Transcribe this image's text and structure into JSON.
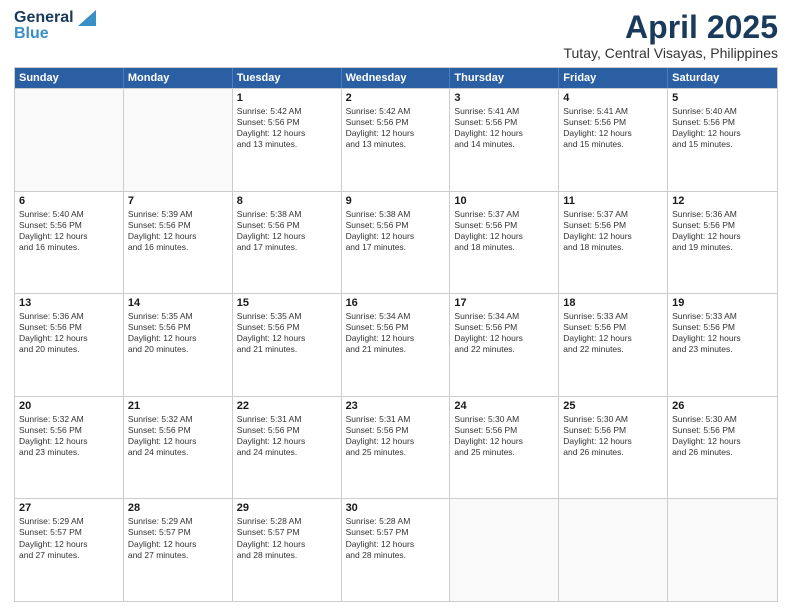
{
  "logo": {
    "general": "General",
    "blue": "Blue"
  },
  "title": "April 2025",
  "subtitle": "Tutay, Central Visayas, Philippines",
  "weekdays": [
    "Sunday",
    "Monday",
    "Tuesday",
    "Wednesday",
    "Thursday",
    "Friday",
    "Saturday"
  ],
  "weeks": [
    [
      {
        "day": "",
        "lines": []
      },
      {
        "day": "",
        "lines": []
      },
      {
        "day": "1",
        "lines": [
          "Sunrise: 5:42 AM",
          "Sunset: 5:56 PM",
          "Daylight: 12 hours",
          "and 13 minutes."
        ]
      },
      {
        "day": "2",
        "lines": [
          "Sunrise: 5:42 AM",
          "Sunset: 5:56 PM",
          "Daylight: 12 hours",
          "and 13 minutes."
        ]
      },
      {
        "day": "3",
        "lines": [
          "Sunrise: 5:41 AM",
          "Sunset: 5:56 PM",
          "Daylight: 12 hours",
          "and 14 minutes."
        ]
      },
      {
        "day": "4",
        "lines": [
          "Sunrise: 5:41 AM",
          "Sunset: 5:56 PM",
          "Daylight: 12 hours",
          "and 15 minutes."
        ]
      },
      {
        "day": "5",
        "lines": [
          "Sunrise: 5:40 AM",
          "Sunset: 5:56 PM",
          "Daylight: 12 hours",
          "and 15 minutes."
        ]
      }
    ],
    [
      {
        "day": "6",
        "lines": [
          "Sunrise: 5:40 AM",
          "Sunset: 5:56 PM",
          "Daylight: 12 hours",
          "and 16 minutes."
        ]
      },
      {
        "day": "7",
        "lines": [
          "Sunrise: 5:39 AM",
          "Sunset: 5:56 PM",
          "Daylight: 12 hours",
          "and 16 minutes."
        ]
      },
      {
        "day": "8",
        "lines": [
          "Sunrise: 5:38 AM",
          "Sunset: 5:56 PM",
          "Daylight: 12 hours",
          "and 17 minutes."
        ]
      },
      {
        "day": "9",
        "lines": [
          "Sunrise: 5:38 AM",
          "Sunset: 5:56 PM",
          "Daylight: 12 hours",
          "and 17 minutes."
        ]
      },
      {
        "day": "10",
        "lines": [
          "Sunrise: 5:37 AM",
          "Sunset: 5:56 PM",
          "Daylight: 12 hours",
          "and 18 minutes."
        ]
      },
      {
        "day": "11",
        "lines": [
          "Sunrise: 5:37 AM",
          "Sunset: 5:56 PM",
          "Daylight: 12 hours",
          "and 18 minutes."
        ]
      },
      {
        "day": "12",
        "lines": [
          "Sunrise: 5:36 AM",
          "Sunset: 5:56 PM",
          "Daylight: 12 hours",
          "and 19 minutes."
        ]
      }
    ],
    [
      {
        "day": "13",
        "lines": [
          "Sunrise: 5:36 AM",
          "Sunset: 5:56 PM",
          "Daylight: 12 hours",
          "and 20 minutes."
        ]
      },
      {
        "day": "14",
        "lines": [
          "Sunrise: 5:35 AM",
          "Sunset: 5:56 PM",
          "Daylight: 12 hours",
          "and 20 minutes."
        ]
      },
      {
        "day": "15",
        "lines": [
          "Sunrise: 5:35 AM",
          "Sunset: 5:56 PM",
          "Daylight: 12 hours",
          "and 21 minutes."
        ]
      },
      {
        "day": "16",
        "lines": [
          "Sunrise: 5:34 AM",
          "Sunset: 5:56 PM",
          "Daylight: 12 hours",
          "and 21 minutes."
        ]
      },
      {
        "day": "17",
        "lines": [
          "Sunrise: 5:34 AM",
          "Sunset: 5:56 PM",
          "Daylight: 12 hours",
          "and 22 minutes."
        ]
      },
      {
        "day": "18",
        "lines": [
          "Sunrise: 5:33 AM",
          "Sunset: 5:56 PM",
          "Daylight: 12 hours",
          "and 22 minutes."
        ]
      },
      {
        "day": "19",
        "lines": [
          "Sunrise: 5:33 AM",
          "Sunset: 5:56 PM",
          "Daylight: 12 hours",
          "and 23 minutes."
        ]
      }
    ],
    [
      {
        "day": "20",
        "lines": [
          "Sunrise: 5:32 AM",
          "Sunset: 5:56 PM",
          "Daylight: 12 hours",
          "and 23 minutes."
        ]
      },
      {
        "day": "21",
        "lines": [
          "Sunrise: 5:32 AM",
          "Sunset: 5:56 PM",
          "Daylight: 12 hours",
          "and 24 minutes."
        ]
      },
      {
        "day": "22",
        "lines": [
          "Sunrise: 5:31 AM",
          "Sunset: 5:56 PM",
          "Daylight: 12 hours",
          "and 24 minutes."
        ]
      },
      {
        "day": "23",
        "lines": [
          "Sunrise: 5:31 AM",
          "Sunset: 5:56 PM",
          "Daylight: 12 hours",
          "and 25 minutes."
        ]
      },
      {
        "day": "24",
        "lines": [
          "Sunrise: 5:30 AM",
          "Sunset: 5:56 PM",
          "Daylight: 12 hours",
          "and 25 minutes."
        ]
      },
      {
        "day": "25",
        "lines": [
          "Sunrise: 5:30 AM",
          "Sunset: 5:56 PM",
          "Daylight: 12 hours",
          "and 26 minutes."
        ]
      },
      {
        "day": "26",
        "lines": [
          "Sunrise: 5:30 AM",
          "Sunset: 5:56 PM",
          "Daylight: 12 hours",
          "and 26 minutes."
        ]
      }
    ],
    [
      {
        "day": "27",
        "lines": [
          "Sunrise: 5:29 AM",
          "Sunset: 5:57 PM",
          "Daylight: 12 hours",
          "and 27 minutes."
        ]
      },
      {
        "day": "28",
        "lines": [
          "Sunrise: 5:29 AM",
          "Sunset: 5:57 PM",
          "Daylight: 12 hours",
          "and 27 minutes."
        ]
      },
      {
        "day": "29",
        "lines": [
          "Sunrise: 5:28 AM",
          "Sunset: 5:57 PM",
          "Daylight: 12 hours",
          "and 28 minutes."
        ]
      },
      {
        "day": "30",
        "lines": [
          "Sunrise: 5:28 AM",
          "Sunset: 5:57 PM",
          "Daylight: 12 hours",
          "and 28 minutes."
        ]
      },
      {
        "day": "",
        "lines": []
      },
      {
        "day": "",
        "lines": []
      },
      {
        "day": "",
        "lines": []
      }
    ]
  ]
}
